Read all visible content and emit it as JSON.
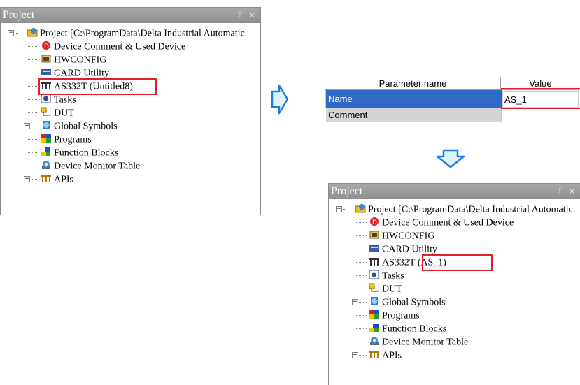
{
  "left_panel": {
    "title": "Project",
    "controls": "\u0007 ×",
    "items": [
      {
        "label": "Project [C:\\ProgramData\\Delta Industrial Automatic",
        "icon": "project-icon"
      },
      {
        "label": "Device Comment & Used Device",
        "icon": "device-comment-icon"
      },
      {
        "label": "HWCONFIG",
        "icon": "hwconfig-icon"
      },
      {
        "label": "CARD Utility",
        "icon": "card-utility-icon"
      },
      {
        "label": "AS332T  (Untitled8)",
        "icon": "plc-module-icon"
      },
      {
        "label": "Tasks",
        "icon": "tasks-icon"
      },
      {
        "label": "DUT",
        "icon": "dut-icon"
      },
      {
        "label": "Global Symbols",
        "icon": "global-symbols-icon"
      },
      {
        "label": "Programs",
        "icon": "programs-icon"
      },
      {
        "label": "Function Blocks",
        "icon": "function-blocks-icon"
      },
      {
        "label": "Device Monitor Table",
        "icon": "device-monitor-icon"
      },
      {
        "label": "APIs",
        "icon": "apis-icon"
      }
    ]
  },
  "param_table": {
    "headers": [
      "Parameter name",
      "Value"
    ],
    "rows": [
      {
        "name": "Name",
        "value": "AS_1"
      },
      {
        "name": "Comment",
        "value": ""
      }
    ]
  },
  "right_panel": {
    "title": "Project",
    "controls": "\u0007 ×",
    "items": [
      {
        "label": "Project [C:\\ProgramData\\Delta Industrial Automatic",
        "icon": "project-icon"
      },
      {
        "label": "Device Comment & Used Device",
        "icon": "device-comment-icon"
      },
      {
        "label": "HWCONFIG",
        "icon": "hwconfig-icon"
      },
      {
        "label": "CARD Utility",
        "icon": "card-utility-icon"
      },
      {
        "label": "AS332T  (AS_1)",
        "icon": "plc-module-icon"
      },
      {
        "label": "Tasks",
        "icon": "tasks-icon"
      },
      {
        "label": "DUT",
        "icon": "dut-icon"
      },
      {
        "label": "Global Symbols",
        "icon": "global-symbols-icon"
      },
      {
        "label": "Programs",
        "icon": "programs-icon"
      },
      {
        "label": "Function Blocks",
        "icon": "function-blocks-icon"
      },
      {
        "label": "Device Monitor Table",
        "icon": "device-monitor-icon"
      },
      {
        "label": "APIs",
        "icon": "apis-icon"
      }
    ]
  },
  "colors": {
    "highlight_box": "#e0202c",
    "arrow_fill": "#dff3fb",
    "arrow_stroke": "#1f7fd6",
    "selected_row": "#3169c6",
    "panel_header": "#9a9a9a"
  }
}
